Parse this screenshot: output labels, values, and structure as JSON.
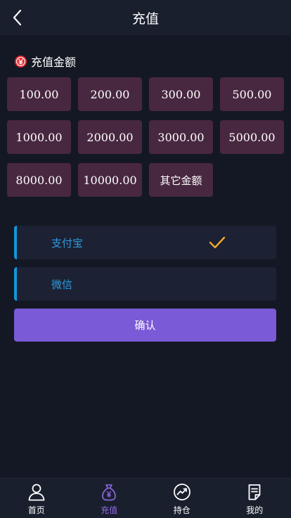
{
  "header": {
    "title": "充值"
  },
  "section": {
    "label": "充值金额"
  },
  "amounts": [
    "100.00",
    "200.00",
    "300.00",
    "500.00",
    "1000.00",
    "2000.00",
    "3000.00",
    "5000.00",
    "8000.00",
    "10000.00",
    "其它金额"
  ],
  "payments": [
    {
      "name": "支付宝",
      "selected": true
    },
    {
      "name": "微信",
      "selected": false
    }
  ],
  "confirm_label": "确认",
  "tabbar": [
    {
      "label": "首页",
      "icon": "user-icon",
      "active": false
    },
    {
      "label": "充值",
      "icon": "money-bag-icon",
      "active": true
    },
    {
      "label": "持仓",
      "icon": "trend-chart-icon",
      "active": false
    },
    {
      "label": "我的",
      "icon": "document-icon",
      "active": false
    }
  ],
  "colors": {
    "background": "#131824",
    "header": "#1a1f2e",
    "amount_button": "#482840",
    "payment_card": "#1c2133",
    "payment_accent": "#1296db",
    "confirm": "#7a5ad6",
    "check": "#f0a92e",
    "active_tab": "#8f6be8"
  }
}
